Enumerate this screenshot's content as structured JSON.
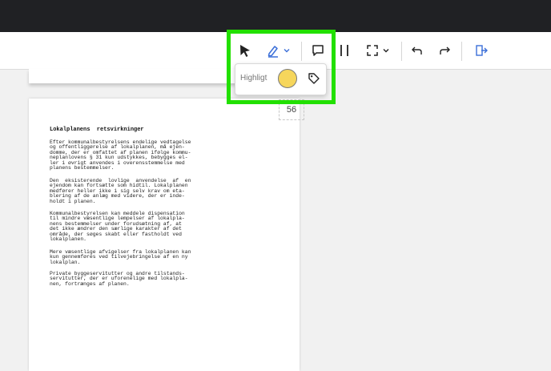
{
  "colors": {
    "highlight_frame": "#22e000",
    "swatch": "#f6d65c",
    "topbar": "#202124"
  },
  "toolbar": {
    "icons": [
      "arrow-pointer-icon",
      "highlighter-icon",
      "chevron-down-icon",
      "comment-icon",
      "text-cursor-icon",
      "crop-icon",
      "chevron-down-icon",
      "undo-icon",
      "redo-icon",
      "export-icon"
    ]
  },
  "popup": {
    "label": "Highligt",
    "swatch_color": "#f6d65c",
    "tag_icon": "tag-icon"
  },
  "page_number": "56",
  "document": {
    "heading": "Lokalplanens  retsvirkninger",
    "paragraphs": [
      "Efter kommunalbestyrelsens endelige vedtagelse\nog offentliggørelse af lokalplanen, må ejen-\ndomme, der er omfattet af planen ifølge kommu-\nneplanlovens § 31 kun udstykkes, bebygges el-\nler i øvrigt anvendes i overensstemmelse med\nplanens bestemmelser.",
      "Den  eksisterende  lovlige  anvendelse  af  en\nejendom kan fortsætte som hidtil. Lokalplanen\nmedfører heller ikke i sig selv krav om eta-\nblering af de anlæg med videre, der er inde-\nholdt i planen.",
      "Kommunalbestyrelsen kan meddele dispensation\ntil mindre væsentlige lempelser af lokalpla-\nnens bestemmelser under forudsætning af, at\ndet ikke ændrer den særlige karakter af det\nområde, der søges skabt eller fastholdt ved\nlokalplanen.",
      "Mere væsentlige afvigelser fra lokalplanen kan\nkun gennemføres ved tilvejebringelse af en ny\nlokalplan.",
      "Private byggeservitutter og andre tilstands-\nservitutter, der er uforenelige med lokalpla-\nnen, fortrænges af planen."
    ]
  }
}
